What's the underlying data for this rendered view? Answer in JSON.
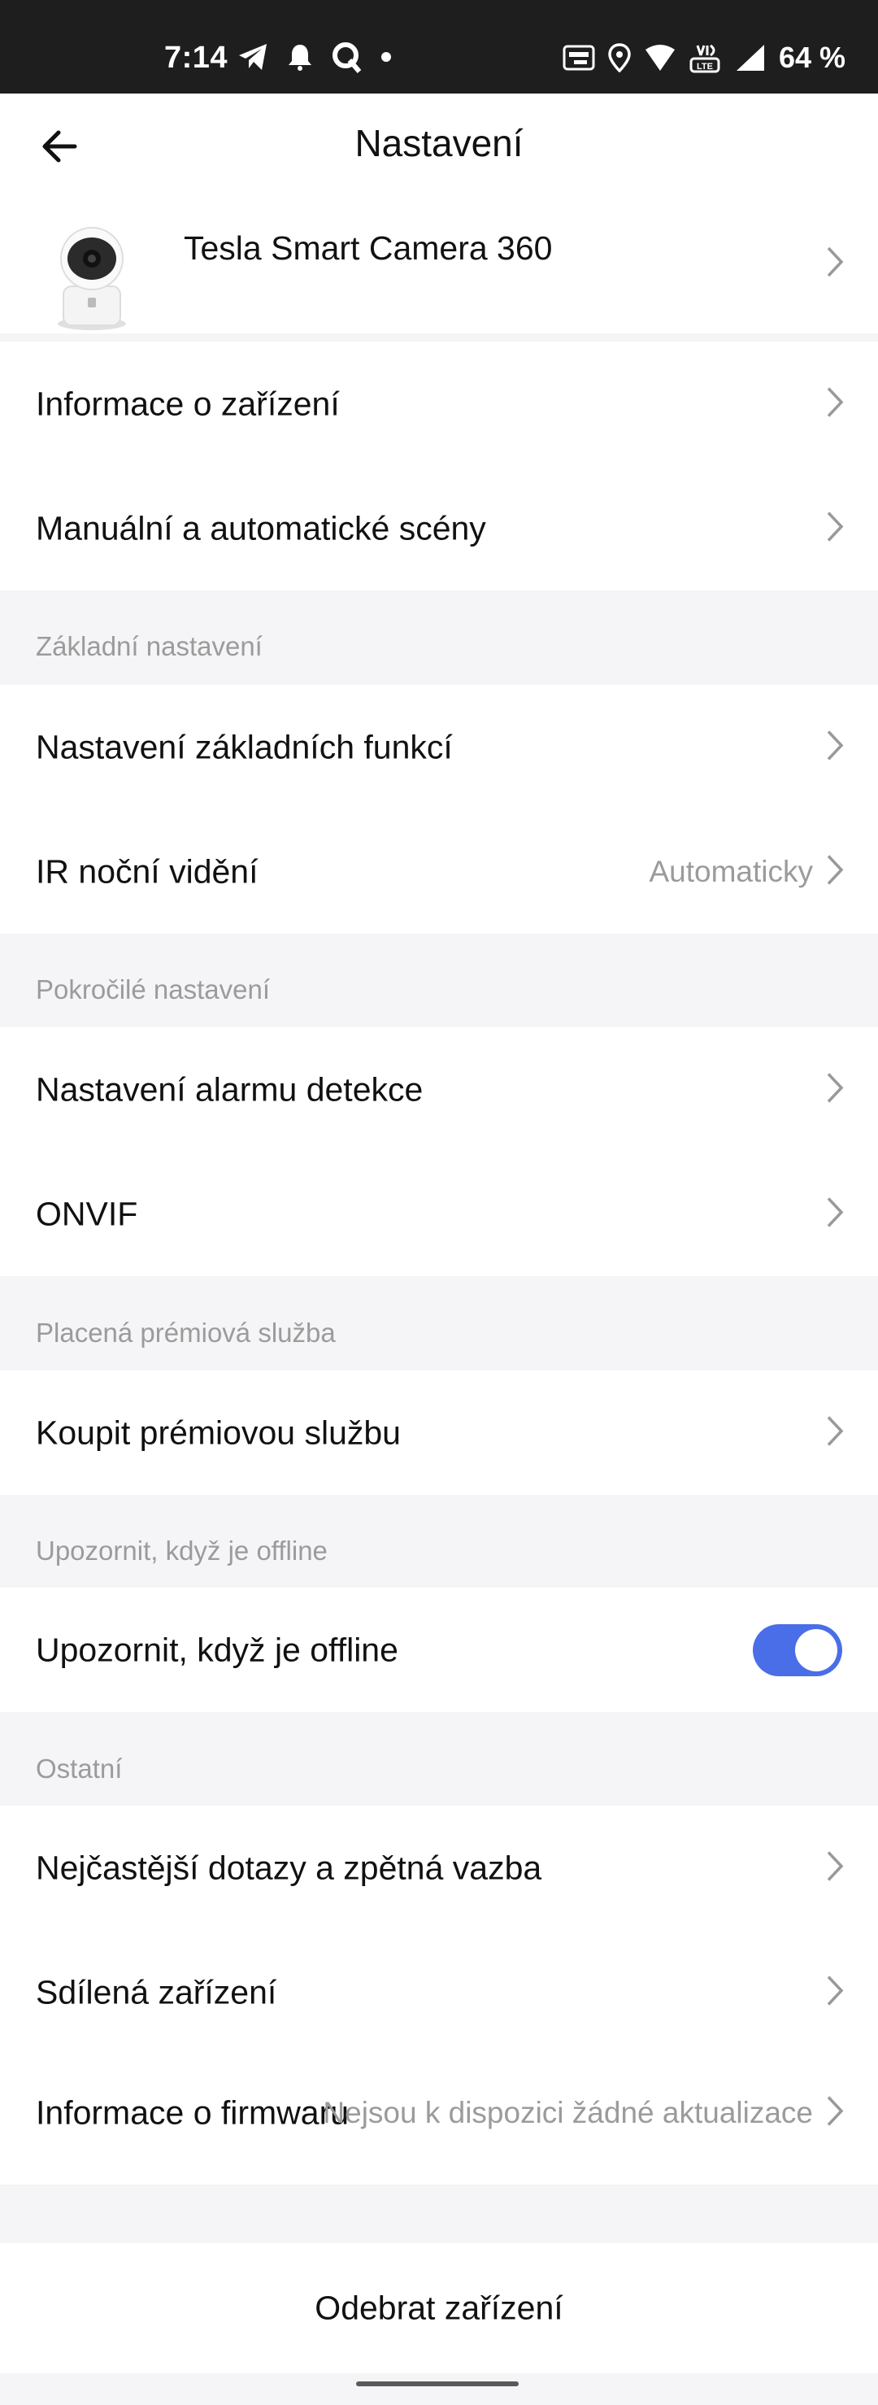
{
  "status_bar": {
    "time": "7:14",
    "battery": "64 %",
    "icons": [
      "telegram-icon",
      "notification-bell-icon",
      "q-app-icon",
      "dot-icon",
      "auto-hd-icon",
      "location-icon",
      "wifi-icon",
      "volte-icon",
      "signal-icon"
    ]
  },
  "header": {
    "title": "Nastavení"
  },
  "device": {
    "name": "Tesla Smart Camera 360"
  },
  "rows": {
    "device_info": "Informace o zařízení",
    "scenes": "Manuální a automatické scény",
    "basic_functions": "Nastavení základních funkcí",
    "ir_night": "IR noční vidění",
    "ir_night_value": "Automaticky",
    "detection_alarm": "Nastavení alarmu detekce",
    "onvif": "ONVIF",
    "buy_premium": "Koupit prémiovou službu",
    "offline_notify": "Upozornit, když je offline",
    "faq": "Nejčastější dotazy a zpětná vazba",
    "shared_devices": "Sdílená zařízení",
    "firmware_info": "Informace o firmwaru",
    "firmware_value": "Nejsou k dispozici žádné aktualizace"
  },
  "sections": {
    "basic": "Základní nastavení",
    "advanced": "Pokročilé nastavení",
    "premium": "Placená prémiová služba",
    "offline": "Upozornit, když je offline",
    "other": "Ostatní"
  },
  "toggle_offline_on": true,
  "remove": {
    "label": "Odebrat zařízení"
  },
  "colors": {
    "accent": "#4a6ee8",
    "background": "#f5f5f7",
    "secondary_text": "#9b9b9b"
  }
}
